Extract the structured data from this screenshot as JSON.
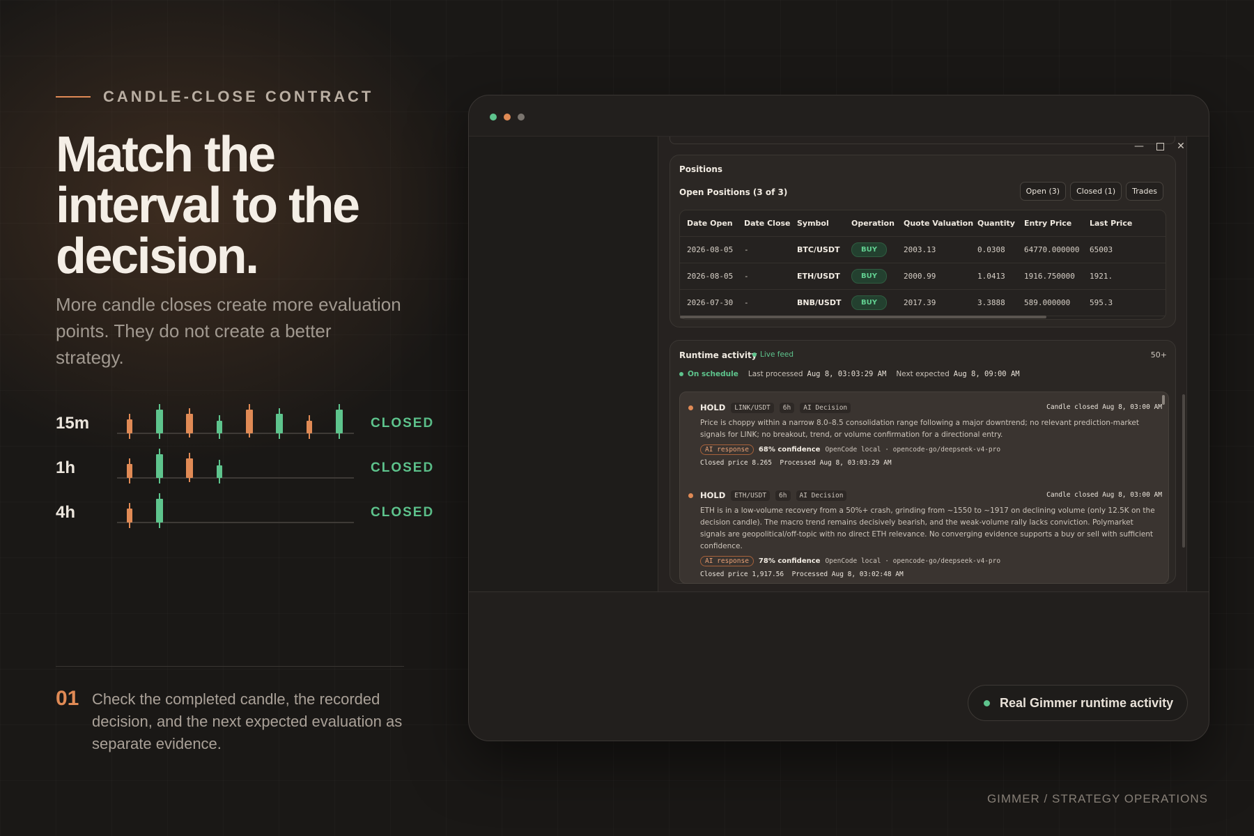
{
  "eyebrow": "CANDLE-CLOSE CONTRACT",
  "headline": "Match the interval to the decision.",
  "subtitle": "More candle closes create more evaluation points. They do not create a better strategy.",
  "intervals": [
    {
      "label": "15m",
      "status": "CLOSED"
    },
    {
      "label": "1h",
      "status": "CLOSED"
    },
    {
      "label": "4h",
      "status": "CLOSED"
    }
  ],
  "step": {
    "number": "01",
    "text": "Check the completed candle, the recorded decision, and the next expected evaluation as separate evidence."
  },
  "footer_brand": "GIMMER / STRATEGY OPERATIONS",
  "colors": {
    "accent": "#e08a55",
    "positive": "#5ec48d",
    "muted_dot": "#7a746e"
  },
  "window": {
    "controls": [
      "minimize-icon",
      "maximize-icon",
      "close-icon"
    ],
    "positions": {
      "title": "Positions",
      "subtitle": "Open Positions (3 of 3)",
      "tabs": [
        "Open (3)",
        "Closed (1)",
        "Trades"
      ],
      "columns": [
        "Date Open",
        "Date Close",
        "Symbol",
        "Operation",
        "Quote Valuation",
        "Quantity",
        "Entry Price",
        "Last Price"
      ],
      "rows": [
        [
          "2026-08-05",
          "-",
          "BTC/USDT",
          "BUY",
          "2003.13",
          "0.0308",
          "64770.000000",
          "65003"
        ],
        [
          "2026-08-05",
          "-",
          "ETH/USDT",
          "BUY",
          "2000.99",
          "1.0413",
          "1916.750000",
          "1921."
        ],
        [
          "2026-07-30",
          "-",
          "BNB/USDT",
          "BUY",
          "2017.39",
          "3.3888",
          "589.000000",
          "595.3"
        ]
      ]
    },
    "runtime": {
      "title": "Runtime activity",
      "live": "Live feed",
      "count": "50+",
      "status": "On schedule",
      "last_label": "Last processed",
      "last_value": "Aug 8, 03:03:29 AM",
      "next_label": "Next expected",
      "next_value": "Aug 8, 09:00 AM",
      "entries": [
        {
          "action": "HOLD",
          "symbol": "LINK/USDT",
          "interval": "6h",
          "kind": "AI Decision",
          "closed_at": "Candle closed Aug 8, 03:00 AM",
          "message": "Price is choppy within a narrow 8.0–8.5 consolidation range following a major downtrend; no relevant prediction-market signals for LINK; no breakout, trend, or volume confirmation for a directional entry.",
          "tag": "AI response",
          "confidence": "68% confidence",
          "model": "OpenCode local · opencode-go/deepseek-v4-pro",
          "closed_price": "Closed price 8.265",
          "processed": "Processed Aug 8, 03:03:29 AM"
        },
        {
          "action": "HOLD",
          "symbol": "ETH/USDT",
          "interval": "6h",
          "kind": "AI Decision",
          "closed_at": "Candle closed Aug 8, 03:00 AM",
          "message": "ETH is in a low-volume recovery from a 50%+ crash, grinding from ~1550 to ~1917 on declining volume (only 12.5K on the decision candle). The macro trend remains decisively bearish, and the weak-volume rally lacks conviction. Polymarket signals are geopolitical/off-topic with no direct ETH relevance. No converging evidence supports a buy or sell with sufficient confidence.",
          "tag": "AI response",
          "confidence": "78% confidence",
          "model": "OpenCode local · opencode-go/deepseek-v4-pro",
          "closed_price": "Closed price 1,917.56",
          "processed": "Processed Aug 8, 03:02:48 AM"
        }
      ]
    },
    "pill": "Real Gimmer runtime activity"
  }
}
